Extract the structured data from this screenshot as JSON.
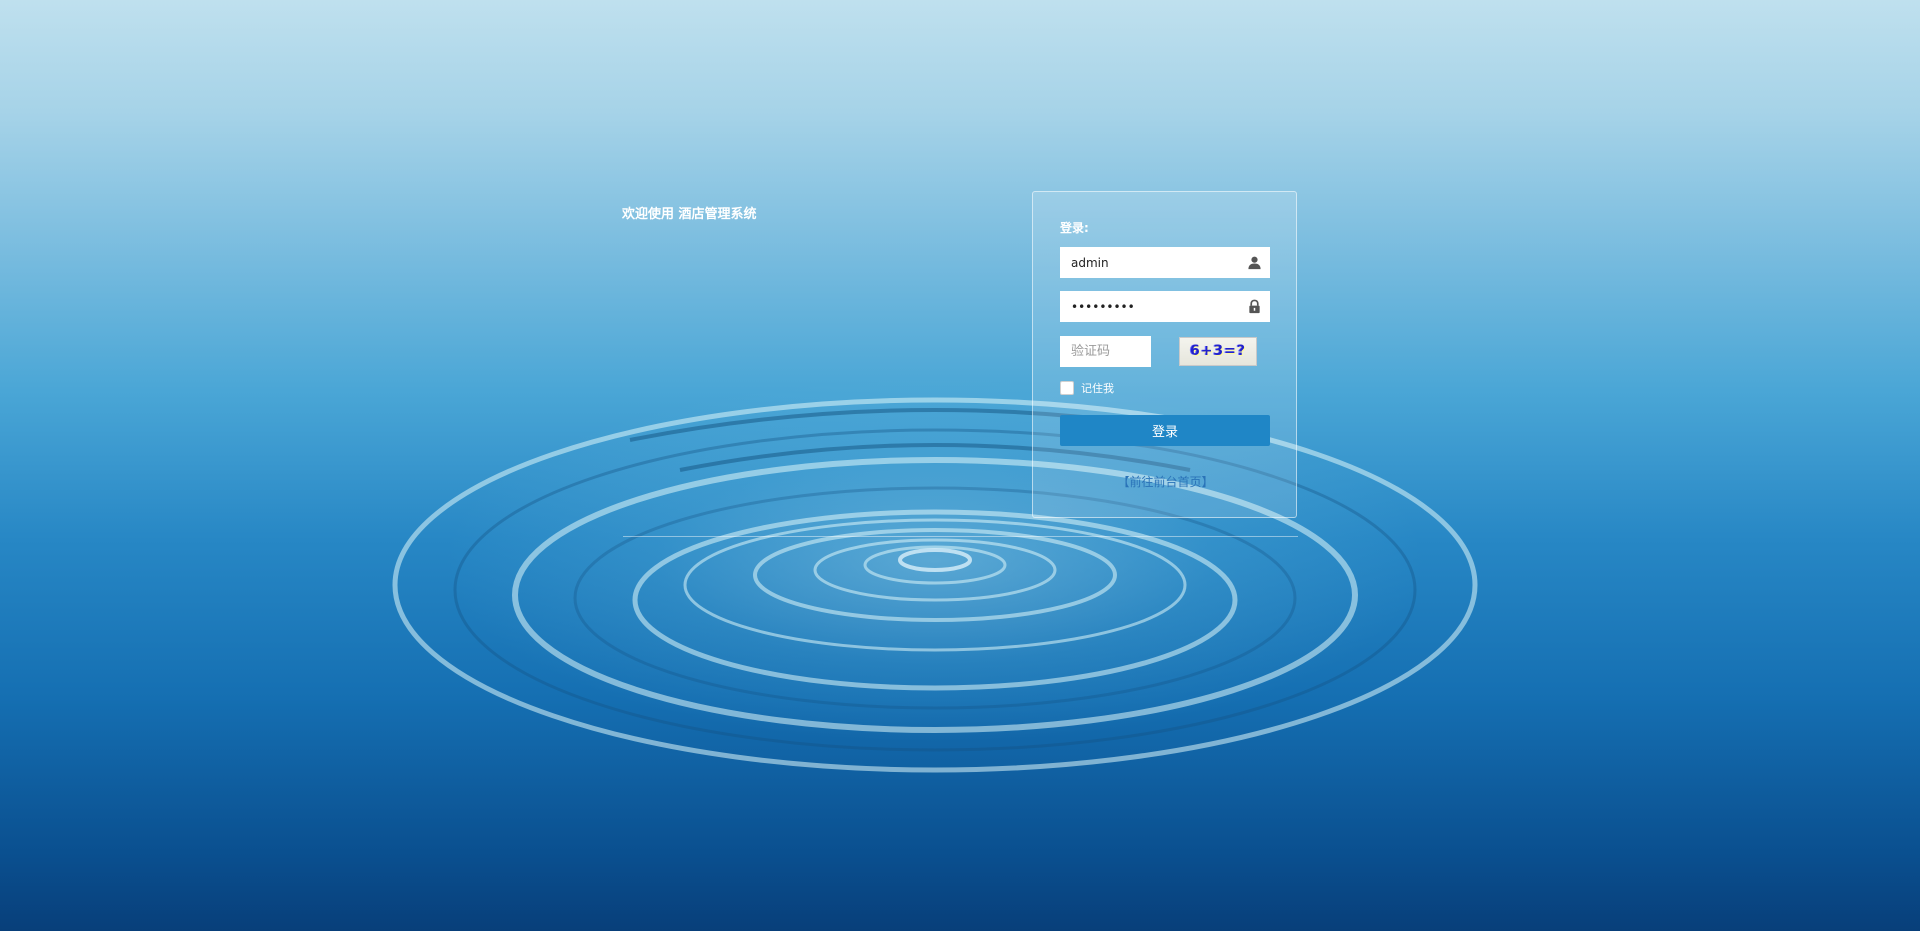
{
  "app": {
    "welcome_text": "欢迎使用 酒店管理系统"
  },
  "login": {
    "title": "登录:",
    "username_value": "admin",
    "password_value": "•••••••••",
    "captcha_placeholder": "验证码",
    "captcha_image_text": "6+3=?",
    "remember_label": "记住我",
    "remember_checked": false,
    "submit_label": "登录",
    "front_link_text": "【前往前台首页】"
  },
  "icons": {
    "username": "user-icon",
    "password": "lock-icon"
  },
  "colors": {
    "accent": "#1f86c6",
    "link": "#2a73b8",
    "captcha_text": "#2222cc"
  }
}
